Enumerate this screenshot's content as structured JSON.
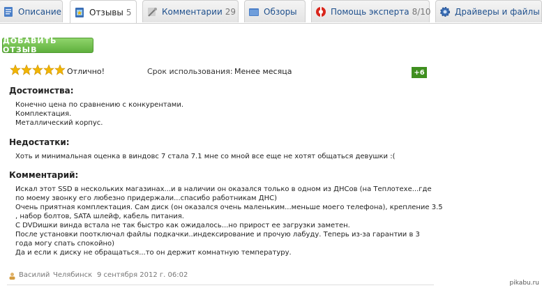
{
  "tabs": [
    {
      "label": "Описание",
      "count": ""
    },
    {
      "label": "Отзывы",
      "count": "5"
    },
    {
      "label": "Комментарии",
      "count": "29"
    },
    {
      "label": "Обзоры",
      "count": ""
    },
    {
      "label": "Помощь эксперта",
      "count": "8/10"
    },
    {
      "label": "Драйверы и файлы",
      "count": ""
    }
  ],
  "add_review_label": "ДОБАВИТЬ ОТЗЫВ",
  "review": {
    "stars": 5,
    "verdict": "Отлично!",
    "usage_label": "Срок использования:",
    "usage_value": "Менее месяца",
    "rating": "+6",
    "pros_title": "Достоинства:",
    "pros": "Конечно цена по сравнению с конкурентами.\nКомплектация.\nМеталлический корпус.",
    "cons_title": "Недостатки:",
    "cons": "Хоть и минимальная оценка в виндовс 7 стала 7.1 мне со мной все еще не хотят общаться девушки :(",
    "comment_title": "Комментарий:",
    "comment": "Искал этот SSD в нескольких магазинах...и в наличии он оказался только в одном из ДНСов (на Теплотехе...где\nпо моему звонку его любезно придержали...спасибо работникам ДНС)\nОчень приятная комплектация. Сам диск (он оказался очень маленьким...меньше моего телефона), крепление 3.5\n, набор болтов, SATA шлейф, кабель питания.\nС DVDишки винда встала не так быстро как ожидалось...но прирост ее загрузки заметен.\nПосле установки поотключал файлы подкачки..индексирование и прочую лабуду. Теперь из-за гарантии в 3\nгода могу спать спокойно)\nДа и если к диску не обращаться...то он держит комнатную температуру.",
    "author": "Василий",
    "city": "Челябинск",
    "date": "9 сентября 2012 г. 06:02"
  },
  "watermark": "pikabu.ru",
  "colors": {
    "accent_green": "#5fb03d",
    "badge_green": "#3f8f1f",
    "link_blue": "#1e4f8c",
    "star": "#f2b600"
  }
}
